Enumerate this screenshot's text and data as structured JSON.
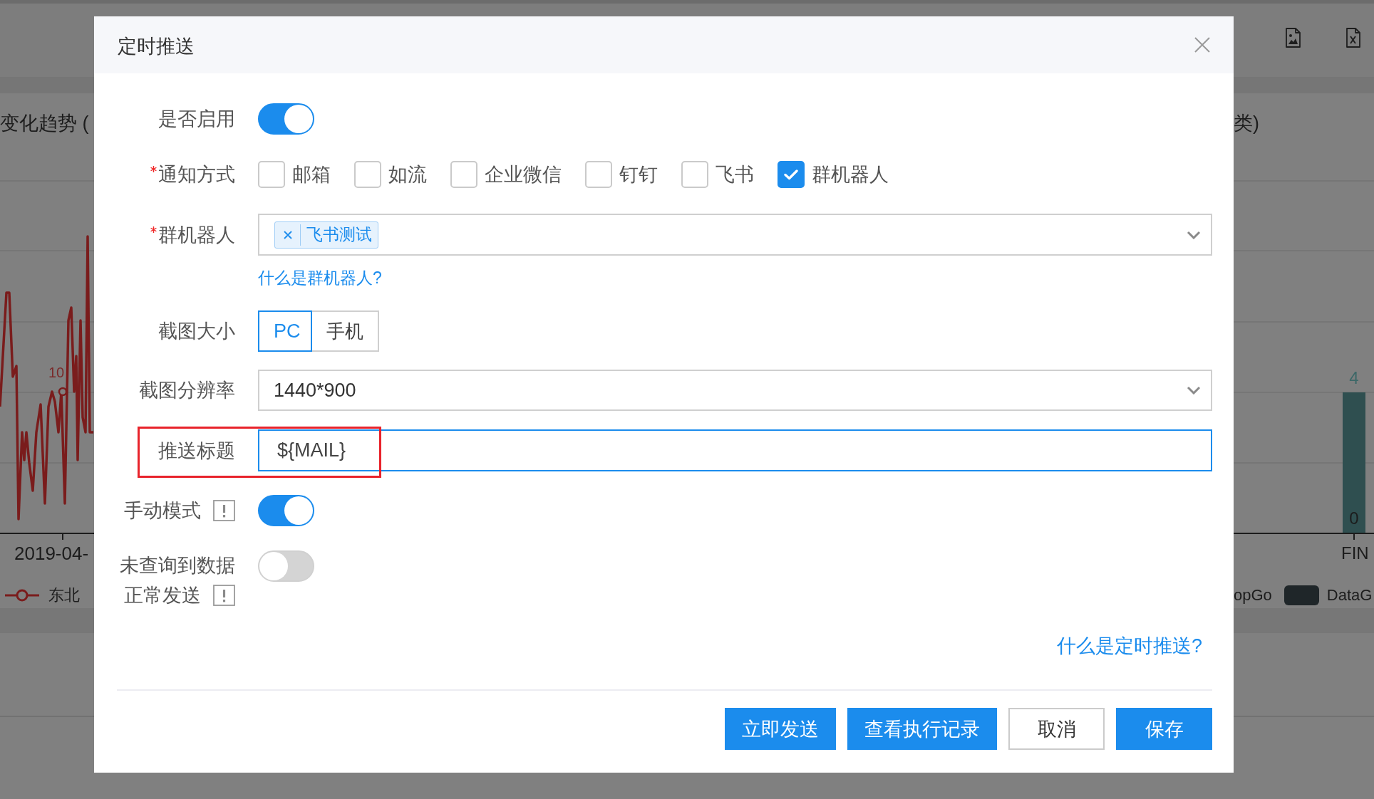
{
  "background": {
    "left_chart": {
      "title": "变化趋势 (",
      "point_label": "10",
      "x_label": "2019-04-",
      "legend": [
        "东北"
      ]
    },
    "right_chart": {
      "title": "类)",
      "bar_label": "4",
      "base_label": "0",
      "x_label": "FIN",
      "legend": [
        {
          "label": "opGo",
          "swatch": false
        },
        {
          "label": "DataG",
          "swatch": true
        }
      ]
    }
  },
  "dialog": {
    "title": "定时推送",
    "fields": [
      {
        "kind": "switch",
        "label": "是否启用",
        "required": false,
        "info": false,
        "on": true
      },
      {
        "kind": "checkboxes",
        "label": "通知方式",
        "required": true,
        "info": false,
        "options": [
          {
            "label": "邮箱",
            "checked": false
          },
          {
            "label": "如流",
            "checked": false
          },
          {
            "label": "企业微信",
            "checked": false
          },
          {
            "label": "钉钉",
            "checked": false
          },
          {
            "label": "飞书",
            "checked": false
          },
          {
            "label": "群机器人",
            "checked": true
          }
        ]
      },
      {
        "kind": "tag_select",
        "label": "群机器人",
        "required": true,
        "info": false,
        "tags": [
          "飞书测试"
        ],
        "help_link": "什么是群机器人?"
      },
      {
        "kind": "segmented",
        "label": "截图大小",
        "required": false,
        "info": false,
        "options": [
          {
            "label": "PC",
            "selected": true
          },
          {
            "label": "手机",
            "selected": false
          }
        ]
      },
      {
        "kind": "select",
        "label": "截图分辨率",
        "required": false,
        "info": false,
        "value": "1440*900"
      },
      {
        "kind": "input",
        "label": "推送标题",
        "required": false,
        "info": false,
        "value": "${MAIL}",
        "focused": true,
        "highlighted": true
      },
      {
        "kind": "switch",
        "label": "手动模式",
        "required": false,
        "info": true,
        "on": true
      },
      {
        "kind": "switch",
        "label_lines": [
          "未查询到数据",
          "正常发送"
        ],
        "required": false,
        "info": true,
        "on": false
      }
    ],
    "help_link": "什么是定时推送?",
    "buttons": [
      {
        "label": "立即发送",
        "primary": true
      },
      {
        "label": "查看执行记录",
        "primary": true
      },
      {
        "label": "取消",
        "primary": false
      },
      {
        "label": "保存",
        "primary": true
      }
    ]
  }
}
